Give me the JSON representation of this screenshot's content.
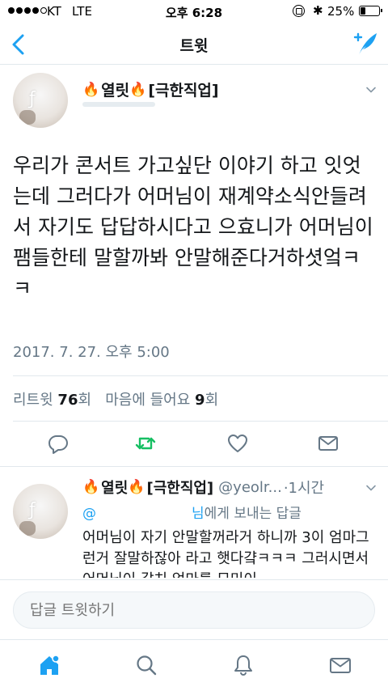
{
  "status_bar": {
    "carrier": "KT",
    "network": "LTE",
    "time": "오후 6:28",
    "battery": "25%"
  },
  "nav": {
    "title": "트윗",
    "back_icon": "chevron-left-icon",
    "compose_icon": "compose-tweet-icon"
  },
  "main_tweet": {
    "display_name": "열릿",
    "bracket_tag": "[극한직업]",
    "text": "우리가 콘서트 가고싶단 이야기 하고 잇엇는데 그러다가 어머님이 재계약소식안들려서 자기도 답답하시다고 으효니가 어머님이 팸들한테 말할까봐 안말해준다거하셧엌ㅋㅋ",
    "timestamp": "2017. 7. 27. 오후 5:00",
    "retweets_label": "리트윗",
    "retweets_count": "76",
    "times_suffix": "회",
    "likes_label": "마음에 들어요",
    "likes_count": "9",
    "retweet_color": "#17bf63"
  },
  "actions": [
    "reply-icon",
    "retweet-icon",
    "like-icon",
    "dm-icon"
  ],
  "reply_tweet": {
    "display_name": "열릿",
    "bracket_tag": "[극한직업]",
    "handle": "@yeolr...",
    "time": "·1시간",
    "reply_to_prefix": "@",
    "reply_to_name": "님",
    "reply_to_suffix": "에게 보내는 답글",
    "text": "어머님이 자기 안말할꺼라거 하니까 3이 엄마그런거 잘말하잖아 라고 햇다걐ㅋㅋㅋ 그러시면서 어머님이 갈치 엄마를 묘미이"
  },
  "composer": {
    "placeholder": "답글 트윗하기"
  },
  "tabs": [
    "home-icon",
    "search-icon",
    "notifications-icon",
    "messages-icon"
  ],
  "colors": {
    "accent": "#1da1f2",
    "text": "#14171a",
    "secondary": "#657786"
  }
}
